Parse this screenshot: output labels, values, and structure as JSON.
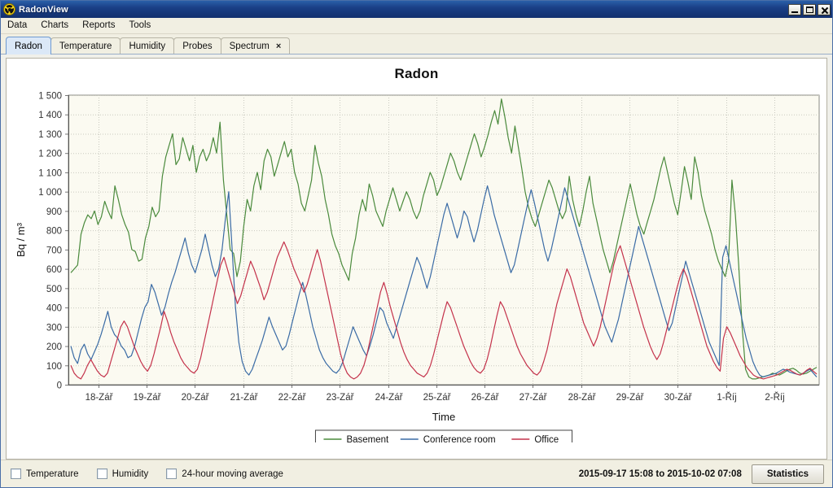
{
  "window": {
    "title": "RadonView",
    "icon": "radiation-trefoil-icon",
    "controls": {
      "minimize": "minimize-icon",
      "maximize": "maximize-icon",
      "close": "close-icon"
    }
  },
  "menubar": {
    "items": [
      {
        "label": "Data"
      },
      {
        "label": "Charts"
      },
      {
        "label": "Reports"
      },
      {
        "label": "Tools"
      }
    ]
  },
  "tabs": [
    {
      "label": "Radon",
      "active": true,
      "closable": false
    },
    {
      "label": "Temperature",
      "active": false,
      "closable": false
    },
    {
      "label": "Humidity",
      "active": false,
      "closable": false
    },
    {
      "label": "Probes",
      "active": false,
      "closable": false
    },
    {
      "label": "Spectrum",
      "active": false,
      "closable": true,
      "close_glyph": "×"
    }
  ],
  "statusbar": {
    "checkboxes": [
      {
        "label": "Temperature",
        "checked": false
      },
      {
        "label": "Humidity",
        "checked": false
      },
      {
        "label": "24-hour moving average",
        "checked": false
      }
    ],
    "range_text": "2015-09-17 15:08 to 2015-10-02 07:08",
    "statistics_label": "Statistics"
  },
  "chart_data": {
    "type": "line",
    "title": "Radon",
    "xlabel": "Time",
    "ylabel": "Bq / m³",
    "ylim": [
      0,
      1500
    ],
    "ytick_step": 100,
    "ytick_labels": [
      "0",
      "100",
      "200",
      "300",
      "400",
      "500",
      "600",
      "700",
      "800",
      "900",
      "1 000",
      "1 100",
      "1 200",
      "1 300",
      "1 400",
      "1 500"
    ],
    "xtick_labels": [
      "18-Zář",
      "19-Zář",
      "20-Zář",
      "21-Zář",
      "22-Zář",
      "23-Zář",
      "24-Zář",
      "25-Zář",
      "26-Zář",
      "27-Zář",
      "28-Zář",
      "29-Zář",
      "30-Zář",
      "1-Říj",
      "2-Říj"
    ],
    "grid": true,
    "legend_position": "bottom",
    "plot_background": "#fbfaf1",
    "grid_color": "#c9c9c0",
    "series": [
      {
        "name": "Basement",
        "color": "#4a8a3c",
        "values": [
          580,
          600,
          620,
          780,
          840,
          880,
          860,
          900,
          830,
          870,
          950,
          900,
          860,
          1030,
          960,
          880,
          830,
          790,
          700,
          690,
          640,
          650,
          760,
          820,
          920,
          870,
          900,
          1080,
          1180,
          1240,
          1300,
          1140,
          1170,
          1280,
          1220,
          1160,
          1240,
          1100,
          1180,
          1220,
          1160,
          1200,
          1280,
          1200,
          1360,
          1060,
          880,
          700,
          680,
          560,
          640,
          820,
          960,
          900,
          1030,
          1100,
          1010,
          1160,
          1220,
          1180,
          1080,
          1140,
          1200,
          1260,
          1180,
          1220,
          1100,
          1040,
          940,
          900,
          980,
          1060,
          1240,
          1150,
          1080,
          960,
          880,
          780,
          720,
          680,
          620,
          580,
          540,
          680,
          760,
          880,
          960,
          900,
          1040,
          980,
          900,
          860,
          820,
          900,
          960,
          1020,
          960,
          900,
          950,
          1000,
          960,
          900,
          860,
          900,
          980,
          1040,
          1100,
          1060,
          980,
          1020,
          1080,
          1140,
          1200,
          1160,
          1100,
          1060,
          1120,
          1180,
          1240,
          1300,
          1250,
          1180,
          1230,
          1290,
          1360,
          1420,
          1350,
          1480,
          1390,
          1280,
          1200,
          1340,
          1230,
          1120,
          1000,
          920,
          860,
          820,
          880,
          940,
          1000,
          1060,
          1020,
          960,
          900,
          860,
          900,
          1080,
          960,
          880,
          820,
          900,
          1000,
          1080,
          940,
          860,
          780,
          700,
          640,
          580,
          640,
          720,
          800,
          880,
          960,
          1040,
          960,
          880,
          820,
          780,
          840,
          900,
          960,
          1040,
          1120,
          1180,
          1100,
          1020,
          940,
          880,
          1000,
          1130,
          1050,
          960,
          1180,
          1100,
          980,
          900,
          840,
          780,
          700,
          640,
          600,
          560,
          640,
          1060,
          880,
          620,
          300,
          80,
          40,
          30,
          30,
          35,
          40,
          45,
          50,
          60,
          55,
          50,
          60,
          70,
          80,
          85,
          75,
          60,
          55,
          60,
          70,
          80,
          90
        ]
      },
      {
        "name": "Conference room",
        "color": "#3a6ba5",
        "values": [
          200,
          140,
          110,
          180,
          210,
          160,
          130,
          170,
          210,
          260,
          320,
          380,
          300,
          260,
          240,
          200,
          180,
          140,
          150,
          200,
          270,
          340,
          400,
          430,
          520,
          480,
          420,
          360,
          400,
          470,
          530,
          580,
          640,
          700,
          760,
          680,
          620,
          580,
          640,
          700,
          780,
          700,
          620,
          560,
          600,
          700,
          860,
          1000,
          700,
          400,
          220,
          120,
          70,
          50,
          80,
          130,
          180,
          230,
          290,
          350,
          300,
          260,
          220,
          180,
          200,
          260,
          330,
          400,
          470,
          530,
          460,
          380,
          300,
          240,
          180,
          140,
          110,
          90,
          70,
          60,
          80,
          120,
          180,
          240,
          300,
          260,
          220,
          180,
          150,
          200,
          260,
          330,
          400,
          380,
          320,
          280,
          240,
          300,
          360,
          420,
          480,
          540,
          600,
          660,
          620,
          560,
          500,
          560,
          640,
          720,
          800,
          880,
          940,
          880,
          820,
          760,
          820,
          900,
          870,
          800,
          740,
          800,
          880,
          960,
          1030,
          960,
          880,
          820,
          760,
          700,
          640,
          580,
          620,
          700,
          780,
          860,
          940,
          1010,
          940,
          860,
          780,
          700,
          640,
          700,
          780,
          860,
          940,
          1020,
          960,
          900,
          840,
          780,
          720,
          660,
          600,
          540,
          480,
          420,
          360,
          300,
          260,
          220,
          280,
          340,
          420,
          500,
          580,
          660,
          740,
          820,
          760,
          700,
          640,
          580,
          520,
          460,
          400,
          340,
          280,
          320,
          400,
          480,
          560,
          640,
          580,
          520,
          460,
          400,
          340,
          280,
          220,
          180,
          140,
          100,
          660,
          720,
          640,
          560,
          480,
          400,
          320,
          240,
          180,
          120,
          80,
          50,
          40,
          45,
          50,
          55,
          60,
          70,
          80,
          75,
          65,
          60,
          55,
          50,
          60,
          70,
          80,
          60,
          40
        ]
      },
      {
        "name": "Office",
        "color": "#c4324b",
        "values": [
          100,
          60,
          40,
          30,
          60,
          100,
          130,
          100,
          70,
          50,
          40,
          60,
          120,
          180,
          240,
          300,
          330,
          300,
          250,
          200,
          160,
          120,
          90,
          70,
          100,
          160,
          230,
          300,
          380,
          330,
          270,
          220,
          180,
          140,
          110,
          90,
          70,
          60,
          80,
          140,
          220,
          300,
          380,
          460,
          540,
          620,
          660,
          600,
          540,
          480,
          420,
          460,
          520,
          580,
          640,
          600,
          550,
          500,
          440,
          480,
          540,
          600,
          660,
          700,
          740,
          700,
          650,
          600,
          560,
          520,
          480,
          520,
          580,
          640,
          700,
          640,
          560,
          480,
          400,
          320,
          240,
          160,
          100,
          60,
          40,
          30,
          40,
          60,
          100,
          160,
          240,
          320,
          400,
          480,
          530,
          470,
          400,
          340,
          280,
          220,
          170,
          130,
          100,
          80,
          60,
          50,
          40,
          60,
          100,
          160,
          230,
          300,
          370,
          430,
          400,
          350,
          300,
          250,
          200,
          160,
          120,
          90,
          70,
          60,
          80,
          130,
          200,
          280,
          360,
          430,
          400,
          350,
          300,
          250,
          200,
          160,
          130,
          100,
          80,
          60,
          50,
          70,
          120,
          180,
          260,
          340,
          420,
          480,
          540,
          600,
          560,
          500,
          440,
          380,
          320,
          280,
          240,
          200,
          240,
          300,
          380,
          460,
          540,
          620,
          680,
          720,
          660,
          600,
          540,
          480,
          420,
          360,
          300,
          250,
          200,
          160,
          130,
          160,
          220,
          290,
          360,
          430,
          500,
          560,
          600,
          560,
          500,
          440,
          380,
          320,
          260,
          200,
          160,
          120,
          90,
          70,
          240,
          300,
          270,
          230,
          190,
          150,
          120,
          90,
          70,
          50,
          40,
          35,
          30,
          35,
          40,
          45,
          50,
          60,
          70,
          80,
          75,
          65,
          55,
          50,
          60,
          75,
          85,
          70,
          55
        ]
      }
    ]
  }
}
